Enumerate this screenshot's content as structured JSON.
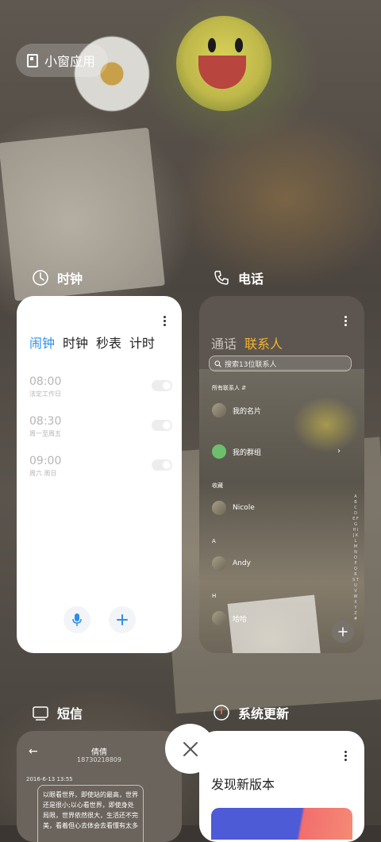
{
  "chip": {
    "label": "小窗应用"
  },
  "apps": {
    "clock": {
      "name": "时钟",
      "tabs": [
        "闹钟",
        "时钟",
        "秒表",
        "计时"
      ],
      "alarms": [
        {
          "time": "08:00",
          "repeat": "法定工作日"
        },
        {
          "time": "08:30",
          "repeat": "周一至周五"
        },
        {
          "time": "09:00",
          "repeat": "周六 周日"
        }
      ]
    },
    "phone": {
      "name": "电话",
      "tabs": [
        "通话",
        "联系人"
      ],
      "search_placeholder": "搜索13位联系人",
      "filter": "所有联系人",
      "contacts": [
        "我的名片",
        "我的群组"
      ],
      "favorites_label": "收藏",
      "favorites": [
        "Nicole"
      ],
      "section_a": "A",
      "contact_a": "Andy",
      "section_h": "H",
      "contact_h": "哈哈",
      "index": "A B C D E F G H I J K L M N O P Q R S T U V W X Y Z #"
    },
    "sms": {
      "name": "短信",
      "contact_name": "倩倩",
      "contact_number": "18730218809",
      "date": "2016-6-13 13:55",
      "message": "以眼看世界，即使站的最高，世界还是很小;以心看世界，即使身处局限，世界依然很大，生活还不完美，看着但心去体会去看懂有太多"
    },
    "update": {
      "name": "系统更新",
      "headline": "发现新版本"
    }
  },
  "colors": {
    "clock_accent": "#2e8ee8",
    "phone_accent": "#f4b32b"
  }
}
